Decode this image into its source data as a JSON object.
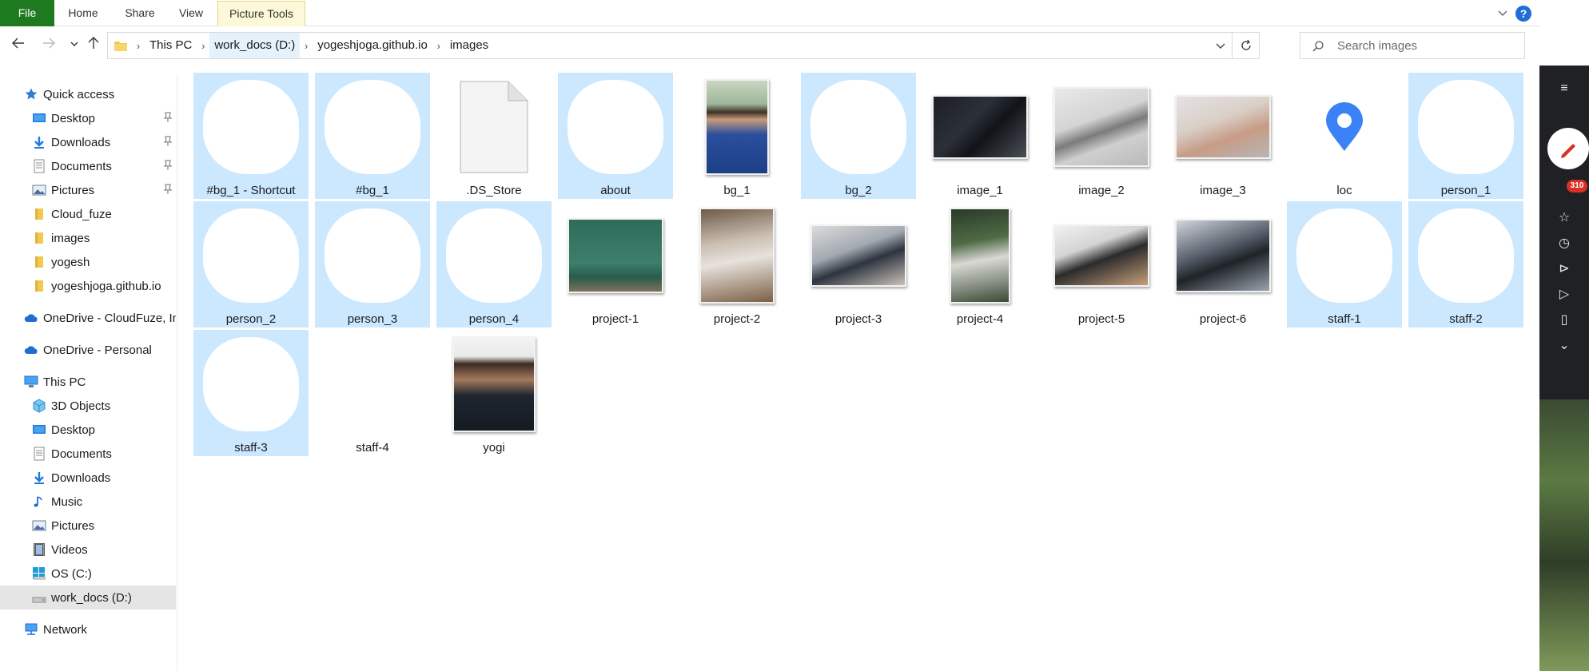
{
  "ribbon": {
    "tabs": [
      "File",
      "Home",
      "Share",
      "View",
      "Picture Tools"
    ],
    "help_label": "?"
  },
  "address": {
    "crumbs": [
      "This PC",
      "work_docs (D:)",
      "yogeshjoga.github.io",
      "images"
    ]
  },
  "search": {
    "placeholder": "Search images"
  },
  "nav": {
    "quick_access": "Quick access",
    "quick_items": [
      "Desktop",
      "Downloads",
      "Documents",
      "Pictures",
      "Cloud_fuze",
      "images",
      "yogesh",
      "yogeshjoga.github.io"
    ],
    "onedrive_business": "OneDrive - CloudFuze, Inc",
    "onedrive_personal": "OneDrive - Personal",
    "this_pc": "This PC",
    "pc_items": [
      "3D Objects",
      "Desktop",
      "Documents",
      "Downloads",
      "Music",
      "Pictures",
      "Videos",
      "OS (C:)",
      "work_docs (D:)"
    ],
    "network": "Network"
  },
  "files": [
    {
      "name": "#bg_1 - Shortcut",
      "selected": true,
      "thumb": "blob"
    },
    {
      "name": "#bg_1",
      "selected": true,
      "thumb": "blob"
    },
    {
      "name": ".DS_Store",
      "selected": false,
      "thumb": "doc-icon"
    },
    {
      "name": "about",
      "selected": true,
      "thumb": "blob"
    },
    {
      "name": "bg_1",
      "selected": false,
      "thumb": "photo-portrait-blue"
    },
    {
      "name": "bg_2",
      "selected": true,
      "thumb": "blob"
    },
    {
      "name": "image_1",
      "selected": false,
      "thumb": "photo-desk-dark"
    },
    {
      "name": "image_2",
      "selected": false,
      "thumb": "photo-laptop-grey"
    },
    {
      "name": "image_3",
      "selected": false,
      "thumb": "photo-desk-warm"
    },
    {
      "name": "loc",
      "selected": false,
      "thumb": "location-pin-icon"
    },
    {
      "name": "person_1",
      "selected": true,
      "thumb": "blob"
    },
    {
      "name": "person_2",
      "selected": true,
      "thumb": "blob"
    },
    {
      "name": "person_3",
      "selected": true,
      "thumb": "blob"
    },
    {
      "name": "person_4",
      "selected": true,
      "thumb": "blob"
    },
    {
      "name": "project-1",
      "selected": false,
      "thumb": "photo-green-sign"
    },
    {
      "name": "project-2",
      "selected": false,
      "thumb": "photo-laptop-desk"
    },
    {
      "name": "project-3",
      "selected": false,
      "thumb": "photo-hands-laptop"
    },
    {
      "name": "project-4",
      "selected": false,
      "thumb": "photo-plant-paper"
    },
    {
      "name": "project-5",
      "selected": false,
      "thumb": "photo-monitor-desk"
    },
    {
      "name": "project-6",
      "selected": false,
      "thumb": "photo-phone-hand"
    },
    {
      "name": "staff-1",
      "selected": true,
      "thumb": "blob"
    },
    {
      "name": "staff-2",
      "selected": true,
      "thumb": "blob"
    },
    {
      "name": "staff-3",
      "selected": true,
      "thumb": "blob"
    },
    {
      "name": "staff-4",
      "selected": false,
      "thumb": "blob"
    },
    {
      "name": "yogi",
      "selected": false,
      "thumb": "photo-portrait-suit"
    }
  ],
  "side_strip": {
    "badge": "310"
  },
  "colors": {
    "file_tab": "#1e7a1e",
    "selection": "#cce8ff",
    "accent": "#1f6ed4",
    "folder": "#f2c94c"
  }
}
